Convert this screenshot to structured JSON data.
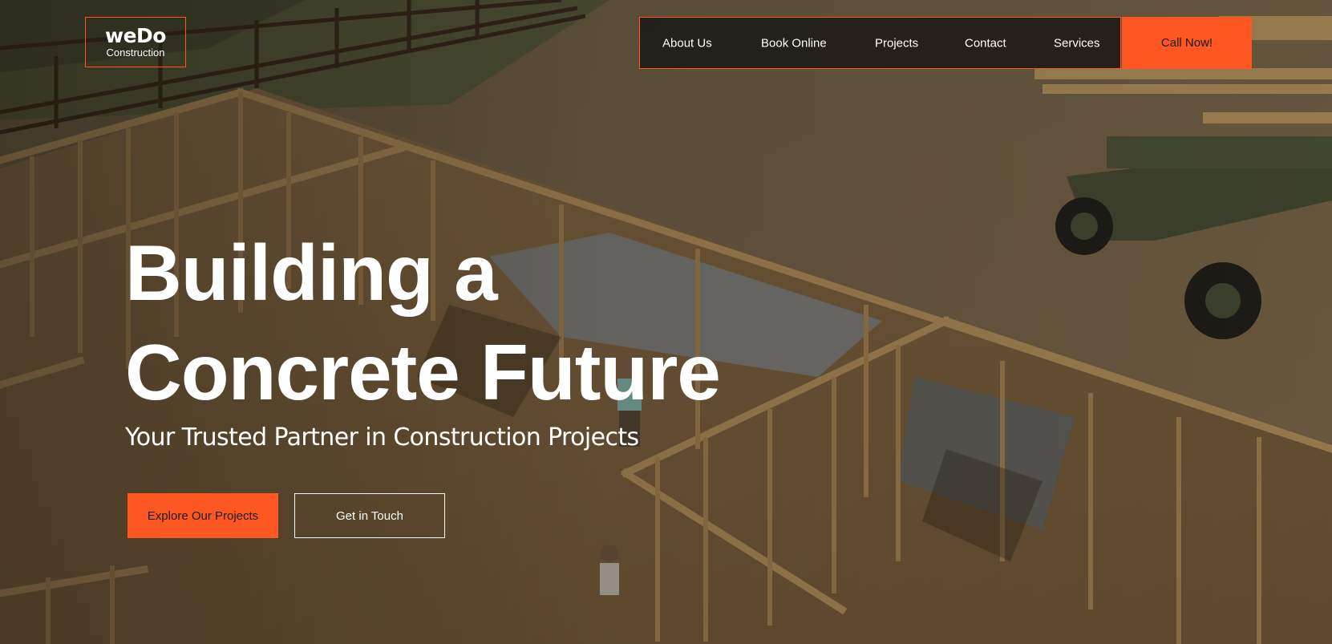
{
  "header": {
    "logo": {
      "name": "weDo",
      "subtitle": "Construction"
    },
    "nav": [
      {
        "label": "About Us"
      },
      {
        "label": "Book Online"
      },
      {
        "label": "Projects"
      },
      {
        "label": "Contact"
      },
      {
        "label": "Services"
      }
    ],
    "cta_label": "Call Now!"
  },
  "hero": {
    "title_line1": "Building a",
    "title_line2": "Concrete Future",
    "subtitle": "Your Trusted Partner in Construction Projects",
    "primary_button": "Explore Our Projects",
    "secondary_button": "Get in Touch"
  },
  "theme": {
    "accent": "#ff5722",
    "text": "#ffffff",
    "nav_bg": "#191614"
  },
  "background": {
    "scene": "construction-site-framing-photo"
  }
}
